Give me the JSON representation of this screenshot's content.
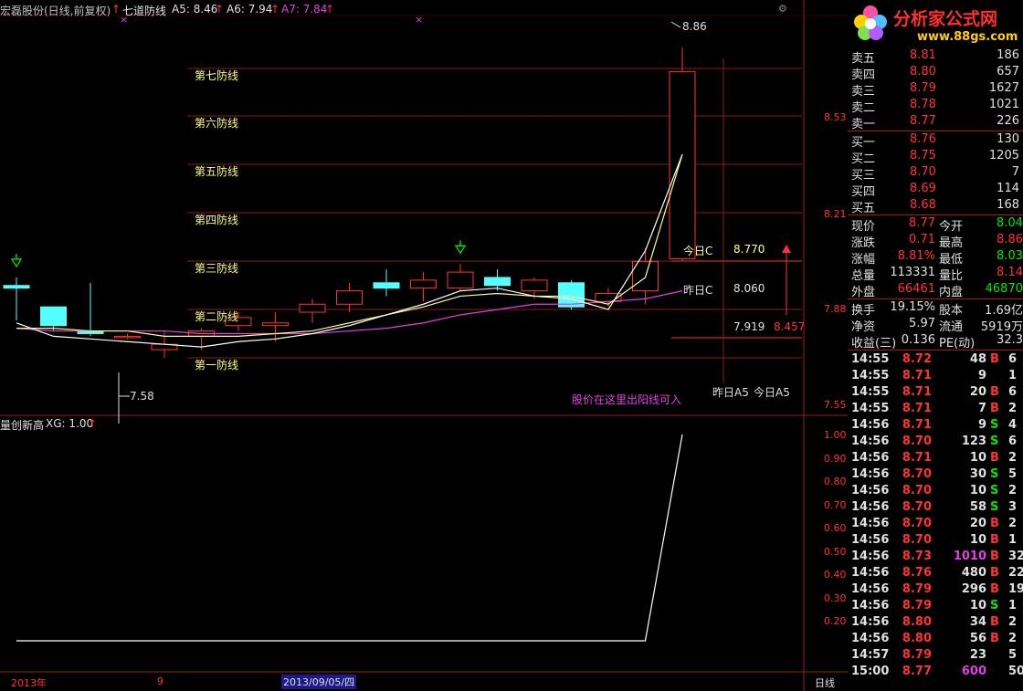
{
  "header": {
    "stock_name": "宏磊股份(日线,前复权)",
    "indicator_name": "七道防线",
    "a5": "A5: 8.46",
    "a6": "A6: 7.94",
    "a7": "A7: 7.84",
    "arrow": "↑"
  },
  "main_chart": {
    "defense_lines": [
      "第七防线",
      "第六防线",
      "第五防线",
      "第四防线",
      "第三防线",
      "第二防线",
      "第一防线"
    ],
    "price_axis": [
      "8.53",
      "8.21",
      "7.88",
      "7.55"
    ],
    "annotations": {
      "high_label": "8.86",
      "low_label": "7.58",
      "today_c_label": "今日C",
      "today_c_value": "8.770",
      "yesterday_c_label": "昨日C",
      "yesterday_c_value": "8.060",
      "a5_value": "7.919",
      "target_value": "8.457",
      "yesterday_a5": "昨日A5",
      "today_a5": "今日A5",
      "buy_hint": "股价在这里出阳线可入"
    },
    "candles": [
      {
        "o": 7.97,
        "c": 7.96,
        "h": 8.0,
        "l": 7.84
      },
      {
        "o": 7.89,
        "c": 7.82,
        "h": 7.88,
        "l": 7.8
      },
      {
        "o": 7.8,
        "c": 7.79,
        "h": 7.98,
        "l": 7.78
      },
      {
        "o": 7.78,
        "c": 7.78,
        "h": 7.79,
        "l": 7.77
      },
      {
        "o": 7.73,
        "c": 7.75,
        "h": 7.8,
        "l": 7.7
      },
      {
        "o": 7.78,
        "c": 7.8,
        "h": 7.81,
        "l": 7.73
      },
      {
        "o": 7.82,
        "c": 7.85,
        "h": 7.87,
        "l": 7.8
      },
      {
        "o": 7.82,
        "c": 7.83,
        "h": 7.87,
        "l": 7.76
      },
      {
        "o": 7.87,
        "c": 7.9,
        "h": 7.92,
        "l": 7.83
      },
      {
        "o": 7.9,
        "c": 7.95,
        "h": 7.98,
        "l": 7.87
      },
      {
        "o": 7.98,
        "c": 7.96,
        "h": 8.03,
        "l": 7.93
      },
      {
        "o": 7.96,
        "c": 7.99,
        "h": 8.02,
        "l": 7.91
      },
      {
        "o": 7.96,
        "c": 8.02,
        "h": 8.05,
        "l": 7.95
      },
      {
        "o": 8.0,
        "c": 7.97,
        "h": 8.03,
        "l": 7.95
      },
      {
        "o": 7.95,
        "c": 7.99,
        "h": 8.0,
        "l": 7.92
      },
      {
        "o": 7.98,
        "c": 7.89,
        "h": 7.99,
        "l": 7.88
      },
      {
        "o": 7.91,
        "c": 7.94,
        "h": 7.96,
        "l": 7.89
      },
      {
        "o": 7.95,
        "c": 8.06,
        "h": 8.11,
        "l": 7.9
      },
      {
        "o": 8.07,
        "c": 8.77,
        "h": 8.86,
        "l": 8.06
      }
    ],
    "white_line": [
      7.83,
      7.78,
      7.77,
      7.76,
      7.75,
      7.74,
      7.76,
      7.77,
      7.79,
      7.82,
      7.86,
      7.9,
      7.95,
      7.96,
      7.93,
      7.92,
      7.88,
      8.1,
      8.46
    ],
    "yellow_line": [
      7.81,
      7.81,
      7.8,
      7.8,
      7.78,
      7.78,
      7.78,
      7.79,
      7.8,
      7.83,
      7.86,
      7.89,
      7.93,
      7.94,
      7.93,
      7.93,
      7.9,
      8.0,
      8.46
    ],
    "magenta_line": [
      7.81,
      7.8,
      7.8,
      7.8,
      7.8,
      7.79,
      7.79,
      7.79,
      7.79,
      7.8,
      7.81,
      7.83,
      7.86,
      7.88,
      7.9,
      7.9,
      7.91,
      7.92,
      7.95
    ],
    "down_arrows": [
      0,
      12
    ]
  },
  "sub_chart": {
    "title": "量创新高",
    "xg": "XG: 1.00",
    "arrow": "↑",
    "axis": [
      "1.00",
      "0.90",
      "0.80",
      "0.70",
      "0.60",
      "0.50",
      "0.40",
      "0.30",
      "0.20"
    ],
    "values": [
      0,
      0,
      0,
      0,
      0,
      0,
      0,
      0,
      0,
      0,
      0,
      0,
      0,
      0,
      0,
      0,
      0,
      0,
      1
    ]
  },
  "bottom_axis": {
    "year": "2013年",
    "month": "9",
    "date": "2013/09/05/四",
    "period": "日线"
  },
  "logo": {
    "title": "分析家公式网",
    "url": "www.88gs.com"
  },
  "quote": {
    "sells": [
      {
        "label": "卖五",
        "price": "8.81",
        "vol": "186"
      },
      {
        "label": "卖四",
        "price": "8.80",
        "vol": "657"
      },
      {
        "label": "卖三",
        "price": "8.79",
        "vol": "1627"
      },
      {
        "label": "卖二",
        "price": "8.78",
        "vol": "1021"
      },
      {
        "label": "卖一",
        "price": "8.77",
        "vol": "226"
      }
    ],
    "buys": [
      {
        "label": "买一",
        "price": "8.76",
        "vol": "130"
      },
      {
        "label": "买二",
        "price": "8.75",
        "vol": "1205"
      },
      {
        "label": "买三",
        "price": "8.70",
        "vol": "7"
      },
      {
        "label": "买四",
        "price": "8.69",
        "vol": "114"
      },
      {
        "label": "买五",
        "price": "8.68",
        "vol": "168"
      }
    ],
    "stats": [
      {
        "l1": "现价",
        "v1": "8.77",
        "l2": "今开",
        "v2": "8.04",
        "c1": "#ff3232",
        "c2": "#00e600"
      },
      {
        "l1": "涨跌",
        "v1": "0.71",
        "l2": "最高",
        "v2": "8.86",
        "c1": "#ff3232",
        "c2": "#ff3232"
      },
      {
        "l1": "涨幅",
        "v1": "8.81%",
        "l2": "最低",
        "v2": "8.03",
        "c1": "#ff3232",
        "c2": "#00e600"
      },
      {
        "l1": "总量",
        "v1": "113331",
        "l2": "量比",
        "v2": "8.14",
        "c1": "#e0e0e0",
        "c2": "#ff3232"
      },
      {
        "l1": "外盘",
        "v1": "66461",
        "l2": "内盘",
        "v2": "46870",
        "c1": "#ff3232",
        "c2": "#00e600"
      }
    ],
    "stats2": [
      {
        "l1": "换手",
        "v1": "19.15%",
        "l2": "股本",
        "v2": "1.69亿"
      },
      {
        "l1": "净资",
        "v1": "5.97",
        "l2": "流通",
        "v2": "5919万"
      },
      {
        "l1": "收益(三)",
        "v1": "0.136",
        "l2": "PE(动)",
        "v2": "32.3"
      }
    ],
    "ticks": [
      {
        "t": "14:55",
        "p": "8.72",
        "v": "48",
        "s": "B",
        "n": "6"
      },
      {
        "t": "14:55",
        "p": "8.71",
        "v": "9",
        "s": "",
        "n": "1"
      },
      {
        "t": "14:55",
        "p": "8.71",
        "v": "20",
        "s": "B",
        "n": "6"
      },
      {
        "t": "14:55",
        "p": "8.71",
        "v": "7",
        "s": "B",
        "n": "2"
      },
      {
        "t": "14:56",
        "p": "8.71",
        "v": "9",
        "s": "S",
        "n": "4"
      },
      {
        "t": "14:56",
        "p": "8.70",
        "v": "123",
        "s": "S",
        "n": "6"
      },
      {
        "t": "14:56",
        "p": "8.71",
        "v": "10",
        "s": "B",
        "n": "2"
      },
      {
        "t": "14:56",
        "p": "8.70",
        "v": "30",
        "s": "S",
        "n": "5"
      },
      {
        "t": "14:56",
        "p": "8.70",
        "v": "10",
        "s": "S",
        "n": "2"
      },
      {
        "t": "14:56",
        "p": "8.70",
        "v": "58",
        "s": "S",
        "n": "3"
      },
      {
        "t": "14:56",
        "p": "8.70",
        "v": "20",
        "s": "B",
        "n": "2"
      },
      {
        "t": "14:56",
        "p": "8.70",
        "v": "10",
        "s": "B",
        "n": "1"
      },
      {
        "t": "14:56",
        "p": "8.73",
        "v": "1010",
        "s": "B",
        "n": "32"
      },
      {
        "t": "14:56",
        "p": "8.76",
        "v": "480",
        "s": "B",
        "n": "22"
      },
      {
        "t": "14:56",
        "p": "8.79",
        "v": "296",
        "s": "B",
        "n": "19"
      },
      {
        "t": "14:56",
        "p": "8.79",
        "v": "10",
        "s": "S",
        "n": "1"
      },
      {
        "t": "14:56",
        "p": "8.80",
        "v": "34",
        "s": "B",
        "n": "2"
      },
      {
        "t": "14:56",
        "p": "8.80",
        "v": "56",
        "s": "B",
        "n": "2"
      },
      {
        "t": "14:57",
        "p": "8.79",
        "v": "23",
        "s": "",
        "n": "5"
      },
      {
        "t": "15:00",
        "p": "8.77",
        "v": "600",
        "s": "",
        "n": "50"
      }
    ]
  }
}
